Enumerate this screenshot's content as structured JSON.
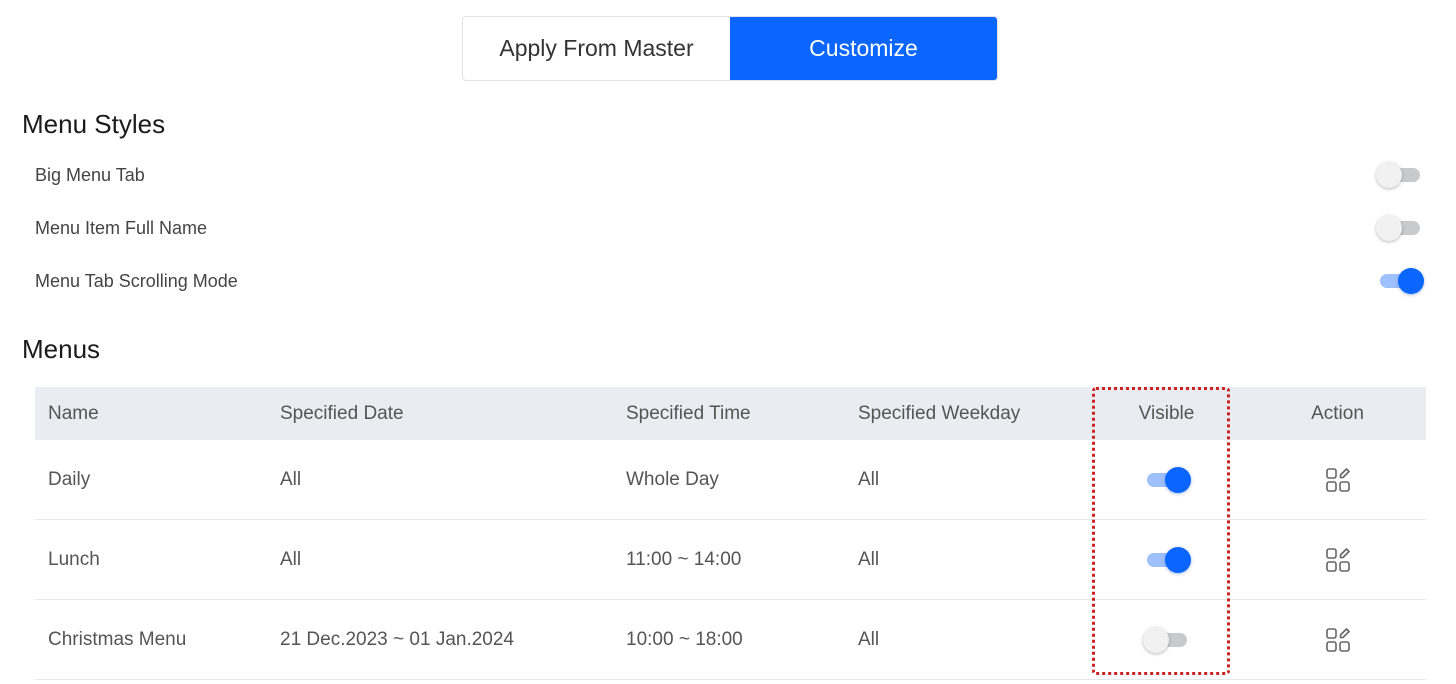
{
  "segmented": {
    "options": [
      "Apply From Master",
      "Customize"
    ],
    "selected": "Customize"
  },
  "menu_styles": {
    "title": "Menu Styles",
    "settings": [
      {
        "label": "Big Menu Tab",
        "enabled": false
      },
      {
        "label": "Menu Item Full Name",
        "enabled": false
      },
      {
        "label": "Menu Tab Scrolling Mode",
        "enabled": true
      }
    ]
  },
  "menus": {
    "title": "Menus",
    "columns": [
      "Name",
      "Specified Date",
      "Specified Time",
      "Specified Weekday",
      "Visible",
      "Action"
    ],
    "rows": [
      {
        "name": "Daily",
        "date": "All",
        "time": "Whole Day",
        "weekday": "All",
        "visible": true,
        "action_icon": "edit-grid-icon"
      },
      {
        "name": "Lunch",
        "date": "All",
        "time": "11:00 ~ 14:00",
        "weekday": "All",
        "visible": true,
        "action_icon": "edit-grid-icon"
      },
      {
        "name": "Christmas Menu",
        "date": "21 Dec.2023 ~ 01 Jan.2024",
        "time": "10:00 ~ 18:00",
        "weekday": "All",
        "visible": false,
        "action_icon": "edit-grid-icon"
      }
    ]
  },
  "colors": {
    "accent": "#0a66ff",
    "toggle_on_track": "#9ec0ff",
    "toggle_off_track": "#c9cacc",
    "table_header_bg": "#e9edf1",
    "highlight_border": "#cc1f1f"
  }
}
